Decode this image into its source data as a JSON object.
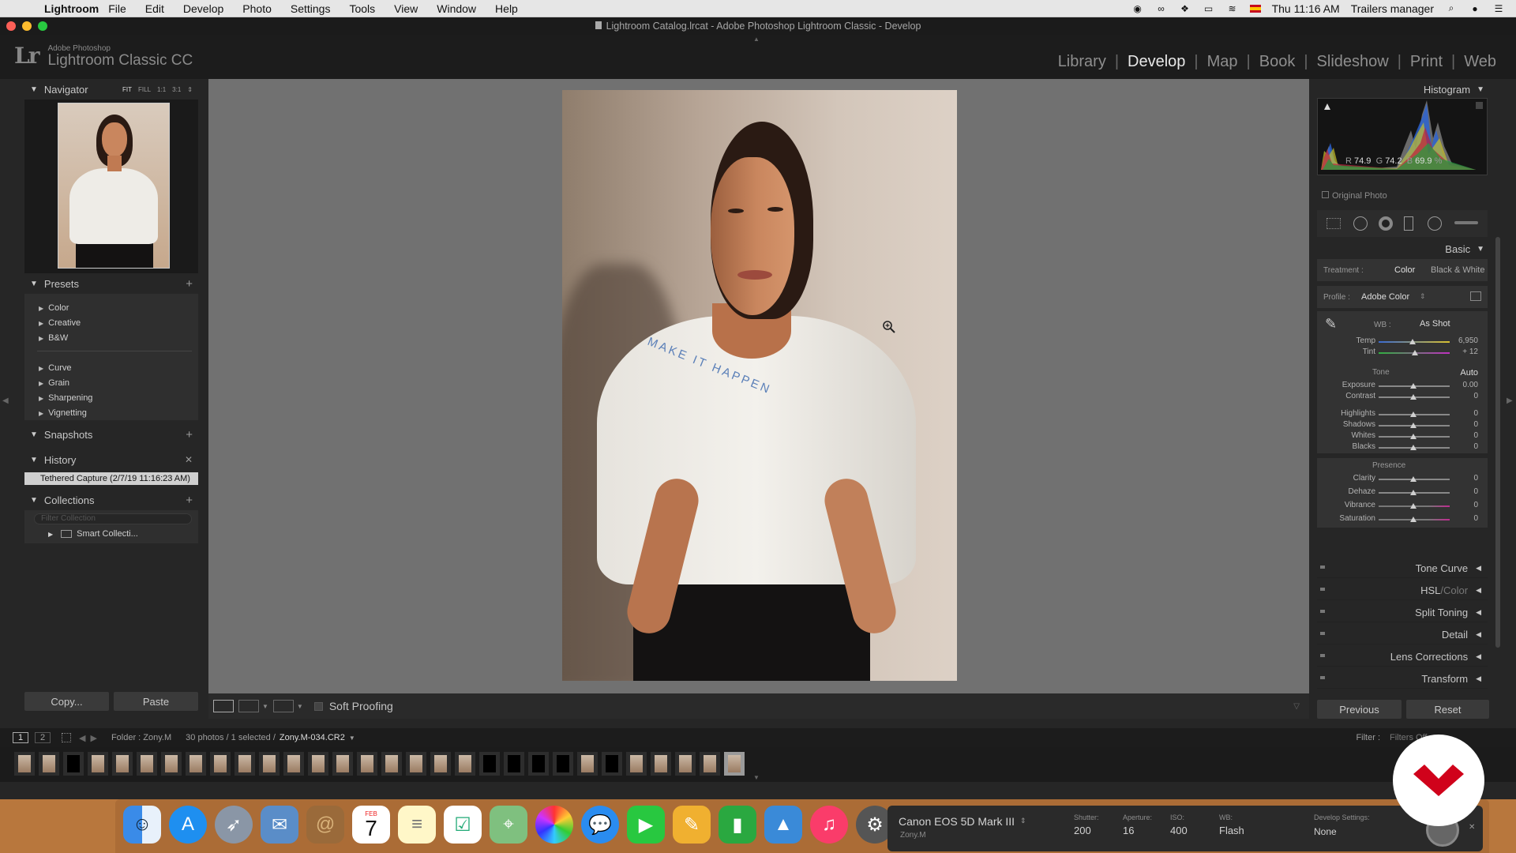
{
  "menubar": {
    "app": "Lightroom",
    "items": [
      "File",
      "Edit",
      "Develop",
      "Photo",
      "Settings",
      "Tools",
      "View",
      "Window",
      "Help"
    ],
    "clock": "Thu 11:16 AM",
    "user": "Trailers manager"
  },
  "window": {
    "title": "Lightroom Catalog.lrcat - Adobe Photoshop Lightroom Classic - Develop"
  },
  "identity": {
    "logo_letters": "Lr",
    "brand_small": "Adobe Photoshop",
    "brand_big": "Lightroom Classic CC"
  },
  "modules": [
    "Library",
    "Develop",
    "Map",
    "Book",
    "Slideshow",
    "Print",
    "Web"
  ],
  "active_module": "Develop",
  "navigator": {
    "title": "Navigator",
    "zoom_options": [
      "FIT",
      "FILL",
      "1:1",
      "3:1"
    ]
  },
  "presets": {
    "title": "Presets",
    "group1": [
      "Color",
      "Creative",
      "B&W"
    ],
    "group2": [
      "Curve",
      "Grain",
      "Sharpening",
      "Vignetting"
    ]
  },
  "snapshots": {
    "title": "Snapshots"
  },
  "history": {
    "title": "History",
    "entry": "Tethered Capture (2/7/19 11:16:23 AM)"
  },
  "collections": {
    "title": "Collections",
    "filter_placeholder": "Filter Collection",
    "item": "Smart Collecti..."
  },
  "left_buttons": {
    "copy": "Copy...",
    "paste": "Paste"
  },
  "toolbar": {
    "soft_proofing": "Soft Proofing"
  },
  "histogram": {
    "title": "Histogram",
    "r_label": "R",
    "r": "74.9",
    "g_label": "G",
    "g": "74.2",
    "b_label": "B",
    "b": "69.9",
    "pct": "%",
    "original": "Original Photo"
  },
  "basic": {
    "title": "Basic",
    "treatment_label": "Treatment :",
    "treatment_color": "Color",
    "treatment_bw": "Black & White",
    "profile_label": "Profile :",
    "profile_value": "Adobe Color",
    "wb_label": "WB :",
    "wb_value": "As Shot",
    "temp": {
      "label": "Temp",
      "value": "6,950"
    },
    "tint": {
      "label": "Tint",
      "value": "+ 12"
    },
    "tone_label": "Tone",
    "auto": "Auto",
    "exposure": {
      "label": "Exposure",
      "value": "0.00"
    },
    "contrast": {
      "label": "Contrast",
      "value": "0"
    },
    "highlights": {
      "label": "Highlights",
      "value": "0"
    },
    "shadows": {
      "label": "Shadows",
      "value": "0"
    },
    "whites": {
      "label": "Whites",
      "value": "0"
    },
    "blacks": {
      "label": "Blacks",
      "value": "0"
    },
    "presence_label": "Presence",
    "clarity": {
      "label": "Clarity",
      "value": "0"
    },
    "dehaze": {
      "label": "Dehaze",
      "value": "0"
    },
    "vibrance": {
      "label": "Vibrance",
      "value": "0"
    },
    "saturation": {
      "label": "Saturation",
      "value": "0"
    }
  },
  "panels": {
    "tone_curve": "Tone Curve",
    "hsl": "HSL",
    "hsl_sep": " / ",
    "hsl_color": "Color",
    "split_toning": "Split Toning",
    "detail": "Detail",
    "lens_corrections": "Lens Corrections",
    "transform": "Transform"
  },
  "right_buttons": {
    "previous": "Previous",
    "reset": "Reset"
  },
  "filmstrip": {
    "page1": "1",
    "page2": "2",
    "folder": "Folder : Zony.M",
    "count": "30 photos / 1 selected /",
    "filename": "Zony.M-034.CR2",
    "filter_label": "Filter :",
    "filter_value": "Filters Off"
  },
  "dock": {
    "calendar_month": "FEB",
    "calendar_day": "7"
  },
  "tether": {
    "camera": "Canon EOS 5D Mark III",
    "owner": "Zony.M",
    "shutter_label": "Shutter:",
    "shutter": "200",
    "aperture_label": "Aperture:",
    "aperture": "16",
    "iso_label": "ISO:",
    "iso": "400",
    "wb_label": "WB:",
    "wb": "Flash",
    "dev_label": "Develop Settings:",
    "dev": "None"
  },
  "shirt_text": "MAKE IT HAPPEN",
  "colors": {
    "accent_red": "#d0021b",
    "panel_bg": "#333333",
    "canvas": "#717171"
  }
}
